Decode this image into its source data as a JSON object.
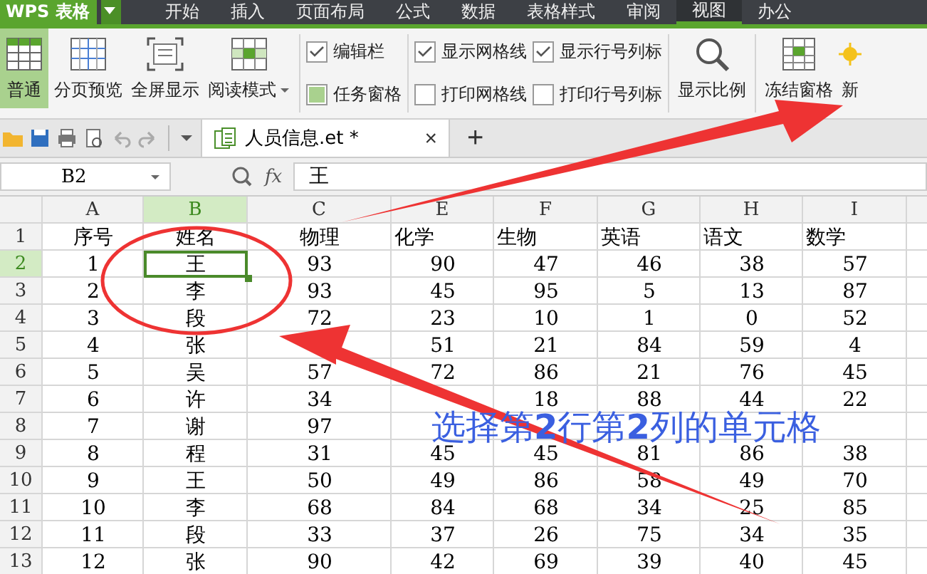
{
  "menu": {
    "app": "WPS 表格",
    "tabs": [
      {
        "label": "开始",
        "selected": false
      },
      {
        "label": "插入",
        "selected": false
      },
      {
        "label": "页面布局",
        "selected": false
      },
      {
        "label": "公式",
        "selected": false
      },
      {
        "label": "数据",
        "selected": false
      },
      {
        "label": "表格样式",
        "selected": false
      },
      {
        "label": "审阅",
        "selected": false
      },
      {
        "label": "视图",
        "selected": true
      },
      {
        "label": "办公",
        "selected": false
      }
    ]
  },
  "ribbon": {
    "views": [
      {
        "label": "普通",
        "kind": "normal",
        "selected": true,
        "dropdown": false
      },
      {
        "label": "分页预览",
        "kind": "pagebreak",
        "selected": false,
        "dropdown": false
      },
      {
        "label": "全屏显示",
        "kind": "fullscreen",
        "selected": false,
        "dropdown": false
      },
      {
        "label": "阅读模式",
        "kind": "reading",
        "selected": false,
        "dropdown": true
      }
    ],
    "panes": [
      {
        "label": "编辑栏",
        "kind": "tick",
        "checked": true
      },
      {
        "label": "任务窗格",
        "kind": "fill",
        "checked": true
      }
    ],
    "grid_options": [
      {
        "label": "显示网格线",
        "checked": true
      },
      {
        "label": "显示行号列标",
        "checked": true
      },
      {
        "label": "打印网格线",
        "checked": false
      },
      {
        "label": "打印行号列标",
        "checked": false
      }
    ],
    "tools": [
      {
        "label": "显示比例",
        "kind": "zoom"
      },
      {
        "label": "冻结窗格",
        "kind": "freeze"
      },
      {
        "label": "新",
        "kind": "new"
      }
    ]
  },
  "doc_tab": {
    "title": "人员信息.et *",
    "close": "×",
    "add": "+"
  },
  "formula_bar": {
    "cell": "B2",
    "fx": "fx",
    "value": "王"
  },
  "sheet": {
    "columns": [
      {
        "label": "A",
        "selected": false
      },
      {
        "label": "B",
        "selected": true
      },
      {
        "label": "C",
        "selected": false
      },
      {
        "label": "E",
        "selected": false
      },
      {
        "label": "F",
        "selected": false
      },
      {
        "label": "G",
        "selected": false
      },
      {
        "label": "H",
        "selected": false
      },
      {
        "label": "I",
        "selected": false
      }
    ],
    "rows": [
      {
        "number": "1",
        "selected": false,
        "cells": [
          "序号",
          "姓名",
          "物理",
          "化学",
          "生物",
          "英语",
          "语文",
          "数学"
        ]
      },
      {
        "number": "2",
        "selected": true,
        "cells": [
          "1",
          "王",
          "93",
          "90",
          "47",
          "46",
          "38",
          "57"
        ]
      },
      {
        "number": "3",
        "selected": false,
        "cells": [
          "2",
          "李",
          "93",
          "45",
          "95",
          "5",
          "13",
          "87"
        ]
      },
      {
        "number": "4",
        "selected": false,
        "cells": [
          "3",
          "段",
          "72",
          "23",
          "10",
          "1",
          "0",
          "52"
        ]
      },
      {
        "number": "5",
        "selected": false,
        "cells": [
          "4",
          "张",
          null,
          "51",
          "21",
          "84",
          "59",
          "4"
        ]
      },
      {
        "number": "6",
        "selected": false,
        "cells": [
          "5",
          "吴",
          "57",
          "72",
          "86",
          "21",
          "76",
          "45"
        ]
      },
      {
        "number": "7",
        "selected": false,
        "cells": [
          "6",
          "许",
          "34",
          null,
          "18",
          "88",
          "44",
          "22"
        ]
      },
      {
        "number": "8",
        "selected": false,
        "cells": [
          "7",
          "谢",
          "97",
          null,
          null,
          null,
          null,
          null
        ]
      },
      {
        "number": "9",
        "selected": false,
        "cells": [
          "8",
          "程",
          "31",
          "45",
          "45",
          "81",
          "86",
          "38"
        ]
      },
      {
        "number": "10",
        "selected": false,
        "cells": [
          "9",
          "王",
          "50",
          "49",
          "86",
          "58",
          "49",
          "70"
        ]
      },
      {
        "number": "11",
        "selected": false,
        "cells": [
          "10",
          "李",
          "68",
          "84",
          "68",
          "34",
          "25",
          "85"
        ]
      },
      {
        "number": "12",
        "selected": false,
        "cells": [
          "11",
          "段",
          "33",
          "37",
          "26",
          "75",
          "34",
          "35"
        ]
      },
      {
        "number": "13",
        "selected": false,
        "cells": [
          "12",
          "张",
          "90",
          "42",
          "69",
          "39",
          "40",
          "45"
        ]
      }
    ]
  },
  "annotation": {
    "text": "选择第**2**行第**2**列的单元格"
  }
}
